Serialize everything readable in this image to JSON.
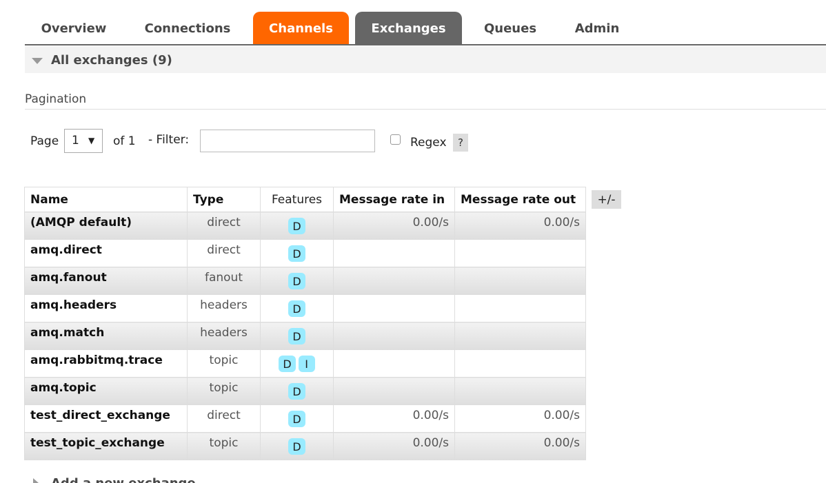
{
  "nav": {
    "tabs": [
      "Overview",
      "Connections",
      "Channels",
      "Exchanges",
      "Queues",
      "Admin"
    ],
    "highlighted_tab": "Channels",
    "active_tab": "Exchanges",
    "colors": {
      "highlight": "#ff6600",
      "active": "#666666"
    }
  },
  "section": {
    "title": "All exchanges (9)"
  },
  "pagination": {
    "label": "Pagination",
    "page_label": "Page",
    "page_value": "1",
    "of_label": "of 1",
    "filter_label": "- Filter:",
    "filter_value": "",
    "regex_label": "Regex",
    "regex_checked": false,
    "help_label": "?"
  },
  "table": {
    "headers": {
      "name": "Name",
      "type": "Type",
      "features": "Features",
      "rate_in": "Message rate in",
      "rate_out": "Message rate out"
    },
    "toggle_label": "+/-",
    "rows": [
      {
        "name": "(AMQP default)",
        "type": "direct",
        "features": [
          "D"
        ],
        "rate_in": "0.00/s",
        "rate_out": "0.00/s"
      },
      {
        "name": "amq.direct",
        "type": "direct",
        "features": [
          "D"
        ],
        "rate_in": "",
        "rate_out": ""
      },
      {
        "name": "amq.fanout",
        "type": "fanout",
        "features": [
          "D"
        ],
        "rate_in": "",
        "rate_out": ""
      },
      {
        "name": "amq.headers",
        "type": "headers",
        "features": [
          "D"
        ],
        "rate_in": "",
        "rate_out": ""
      },
      {
        "name": "amq.match",
        "type": "headers",
        "features": [
          "D"
        ],
        "rate_in": "",
        "rate_out": ""
      },
      {
        "name": "amq.rabbitmq.trace",
        "type": "topic",
        "features": [
          "D",
          "I"
        ],
        "rate_in": "",
        "rate_out": ""
      },
      {
        "name": "amq.topic",
        "type": "topic",
        "features": [
          "D"
        ],
        "rate_in": "",
        "rate_out": ""
      },
      {
        "name": "test_direct_exchange",
        "type": "direct",
        "features": [
          "D"
        ],
        "rate_in": "0.00/s",
        "rate_out": "0.00/s"
      },
      {
        "name": "test_topic_exchange",
        "type": "topic",
        "features": [
          "D"
        ],
        "rate_in": "0.00/s",
        "rate_out": "0.00/s"
      }
    ]
  },
  "add_exchange": {
    "label": "Add a new exchange"
  },
  "badge_color": "#99ebff"
}
